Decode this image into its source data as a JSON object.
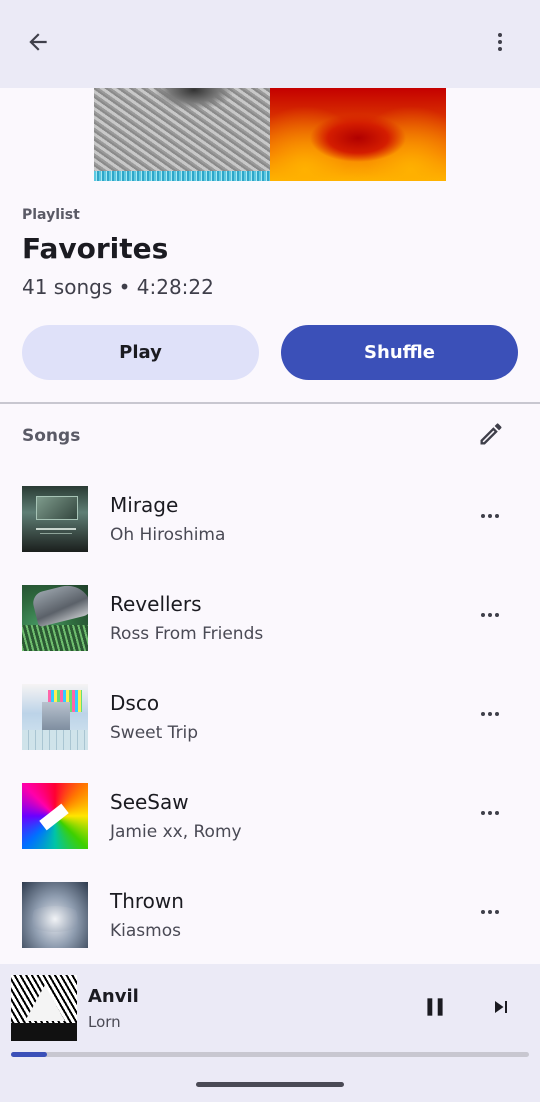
{
  "topbar": {
    "back_icon": "arrow-left-icon",
    "more_icon": "more-vertical-icon"
  },
  "header": {
    "kicker": "Playlist",
    "title": "Favorites",
    "meta": "41 songs • 4:28:22"
  },
  "actions": {
    "play_label": "Play",
    "shuffle_label": "Shuffle",
    "colors": {
      "play_bg": "#dfe1f9",
      "shuffle_bg": "#3b50b8"
    }
  },
  "songs_section": {
    "label": "Songs",
    "edit_icon": "pencil-icon"
  },
  "songs": [
    {
      "title": "Mirage",
      "artist": "Oh Hiroshima",
      "more_icon": "more-horizontal-icon"
    },
    {
      "title": "Revellers",
      "artist": "Ross From Friends",
      "more_icon": "more-horizontal-icon"
    },
    {
      "title": "Dsco",
      "artist": "Sweet Trip",
      "more_icon": "more-horizontal-icon"
    },
    {
      "title": "SeeSaw",
      "artist": "Jamie xx, Romy",
      "more_icon": "more-horizontal-icon"
    },
    {
      "title": "Thrown",
      "artist": "Kiasmos",
      "more_icon": "more-horizontal-icon"
    }
  ],
  "now_playing": {
    "title": "Anvil",
    "artist": "Lorn",
    "progress_fraction": 0.07,
    "pause_icon": "pause-icon",
    "next_icon": "skip-next-icon"
  },
  "theme": {
    "accent": "#3b50b8",
    "surface": "#ebeaf6",
    "background": "#fbf8fd"
  }
}
